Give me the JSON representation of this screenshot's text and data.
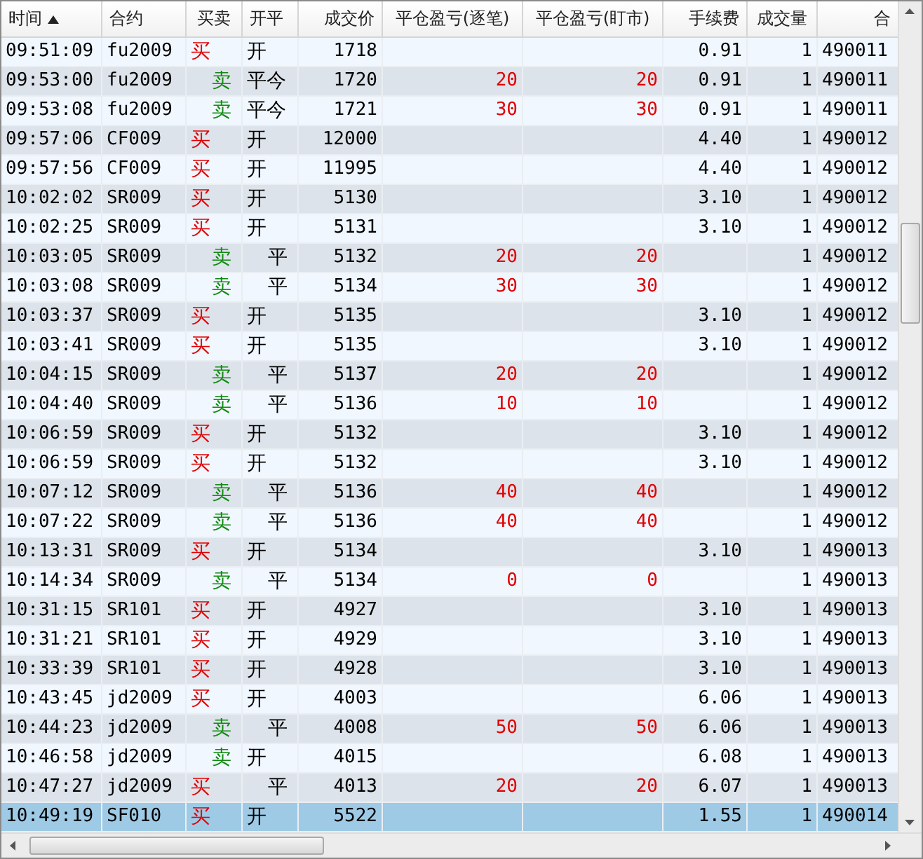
{
  "table": {
    "columns": [
      {
        "label": "时间",
        "sorted": true
      },
      {
        "label": "合约"
      },
      {
        "label": "买卖"
      },
      {
        "label": "开平"
      },
      {
        "label": "成交价"
      },
      {
        "label": "平仓盈亏(逐笔)"
      },
      {
        "label": "平仓盈亏(盯市)"
      },
      {
        "label": "手续费"
      },
      {
        "label": "成交量"
      },
      {
        "label": "合"
      }
    ],
    "rows": [
      {
        "time": "09:51:09",
        "contract": "fu2009",
        "side": {
          "kind": "buy",
          "label": "买"
        },
        "offset": {
          "kind": "open",
          "label": "开"
        },
        "price": "1718",
        "fee": "0.91",
        "volume": "1",
        "column_10": "490011",
        "selected": false
      },
      {
        "time": "09:53:00",
        "contract": "fu2009",
        "side": {
          "kind": "sell",
          "label": "卖"
        },
        "offset": {
          "kind": "today",
          "label": "平今"
        },
        "price": "1720",
        "pnl_trade": "20",
        "pnl_market": "20",
        "fee": "0.91",
        "volume": "1",
        "column_10": "490011",
        "selected": false
      },
      {
        "time": "09:53:08",
        "contract": "fu2009",
        "side": {
          "kind": "sell",
          "label": "卖"
        },
        "offset": {
          "kind": "today",
          "label": "平今"
        },
        "price": "1721",
        "pnl_trade": "30",
        "pnl_market": "30",
        "fee": "0.91",
        "volume": "1",
        "column_10": "490011",
        "selected": false
      },
      {
        "time": "09:57:06",
        "contract": "CF009",
        "side": {
          "kind": "buy",
          "label": "买"
        },
        "offset": {
          "kind": "open",
          "label": "开"
        },
        "price": "12000",
        "fee": "4.40",
        "volume": "1",
        "column_10": "490012",
        "selected": false
      },
      {
        "time": "09:57:56",
        "contract": "CF009",
        "side": {
          "kind": "buy",
          "label": "买"
        },
        "offset": {
          "kind": "open",
          "label": "开"
        },
        "price": "11995",
        "fee": "4.40",
        "volume": "1",
        "column_10": "490012",
        "selected": false
      },
      {
        "time": "10:02:02",
        "contract": "SR009",
        "side": {
          "kind": "buy",
          "label": "买"
        },
        "offset": {
          "kind": "open",
          "label": "开"
        },
        "price": "5130",
        "fee": "3.10",
        "volume": "1",
        "column_10": "490012",
        "selected": false
      },
      {
        "time": "10:02:25",
        "contract": "SR009",
        "side": {
          "kind": "buy",
          "label": "买"
        },
        "offset": {
          "kind": "open",
          "label": "开"
        },
        "price": "5131",
        "fee": "3.10",
        "volume": "1",
        "column_10": "490012",
        "selected": false
      },
      {
        "time": "10:03:05",
        "contract": "SR009",
        "side": {
          "kind": "sell",
          "label": "卖"
        },
        "offset": {
          "kind": "close",
          "label": "平"
        },
        "price": "5132",
        "pnl_trade": "20",
        "pnl_market": "20",
        "volume": "1",
        "column_10": "490012",
        "selected": false
      },
      {
        "time": "10:03:08",
        "contract": "SR009",
        "side": {
          "kind": "sell",
          "label": "卖"
        },
        "offset": {
          "kind": "close",
          "label": "平"
        },
        "price": "5134",
        "pnl_trade": "30",
        "pnl_market": "30",
        "volume": "1",
        "column_10": "490012",
        "selected": false
      },
      {
        "time": "10:03:37",
        "contract": "SR009",
        "side": {
          "kind": "buy",
          "label": "买"
        },
        "offset": {
          "kind": "open",
          "label": "开"
        },
        "price": "5135",
        "fee": "3.10",
        "volume": "1",
        "column_10": "490012",
        "selected": false
      },
      {
        "time": "10:03:41",
        "contract": "SR009",
        "side": {
          "kind": "buy",
          "label": "买"
        },
        "offset": {
          "kind": "open",
          "label": "开"
        },
        "price": "5135",
        "fee": "3.10",
        "volume": "1",
        "column_10": "490012",
        "selected": false
      },
      {
        "time": "10:04:15",
        "contract": "SR009",
        "side": {
          "kind": "sell",
          "label": "卖"
        },
        "offset": {
          "kind": "close",
          "label": "平"
        },
        "price": "5137",
        "pnl_trade": "20",
        "pnl_market": "20",
        "volume": "1",
        "column_10": "490012",
        "selected": false
      },
      {
        "time": "10:04:40",
        "contract": "SR009",
        "side": {
          "kind": "sell",
          "label": "卖"
        },
        "offset": {
          "kind": "close",
          "label": "平"
        },
        "price": "5136",
        "pnl_trade": "10",
        "pnl_market": "10",
        "volume": "1",
        "column_10": "490012",
        "selected": false
      },
      {
        "time": "10:06:59",
        "contract": "SR009",
        "side": {
          "kind": "buy",
          "label": "买"
        },
        "offset": {
          "kind": "open",
          "label": "开"
        },
        "price": "5132",
        "fee": "3.10",
        "volume": "1",
        "column_10": "490012",
        "selected": false
      },
      {
        "time": "10:06:59",
        "contract": "SR009",
        "side": {
          "kind": "buy",
          "label": "买"
        },
        "offset": {
          "kind": "open",
          "label": "开"
        },
        "price": "5132",
        "fee": "3.10",
        "volume": "1",
        "column_10": "490012",
        "selected": false
      },
      {
        "time": "10:07:12",
        "contract": "SR009",
        "side": {
          "kind": "sell",
          "label": "卖"
        },
        "offset": {
          "kind": "close",
          "label": "平"
        },
        "price": "5136",
        "pnl_trade": "40",
        "pnl_market": "40",
        "volume": "1",
        "column_10": "490012",
        "selected": false
      },
      {
        "time": "10:07:22",
        "contract": "SR009",
        "side": {
          "kind": "sell",
          "label": "卖"
        },
        "offset": {
          "kind": "close",
          "label": "平"
        },
        "price": "5136",
        "pnl_trade": "40",
        "pnl_market": "40",
        "volume": "1",
        "column_10": "490012",
        "selected": false
      },
      {
        "time": "10:13:31",
        "contract": "SR009",
        "side": {
          "kind": "buy",
          "label": "买"
        },
        "offset": {
          "kind": "open",
          "label": "开"
        },
        "price": "5134",
        "fee": "3.10",
        "volume": "1",
        "column_10": "490013",
        "selected": false
      },
      {
        "time": "10:14:34",
        "contract": "SR009",
        "side": {
          "kind": "sell",
          "label": "卖"
        },
        "offset": {
          "kind": "close",
          "label": "平"
        },
        "price": "5134",
        "pnl_trade": "0",
        "pnl_market": "0",
        "volume": "1",
        "column_10": "490013",
        "selected": false
      },
      {
        "time": "10:31:15",
        "contract": "SR101",
        "side": {
          "kind": "buy",
          "label": "买"
        },
        "offset": {
          "kind": "open",
          "label": "开"
        },
        "price": "4927",
        "fee": "3.10",
        "volume": "1",
        "column_10": "490013",
        "selected": false
      },
      {
        "time": "10:31:21",
        "contract": "SR101",
        "side": {
          "kind": "buy",
          "label": "买"
        },
        "offset": {
          "kind": "open",
          "label": "开"
        },
        "price": "4929",
        "fee": "3.10",
        "volume": "1",
        "column_10": "490013",
        "selected": false
      },
      {
        "time": "10:33:39",
        "contract": "SR101",
        "side": {
          "kind": "buy",
          "label": "买"
        },
        "offset": {
          "kind": "open",
          "label": "开"
        },
        "price": "4928",
        "fee": "3.10",
        "volume": "1",
        "column_10": "490013",
        "selected": false
      },
      {
        "time": "10:43:45",
        "contract": "jd2009",
        "side": {
          "kind": "buy",
          "label": "买"
        },
        "offset": {
          "kind": "open",
          "label": "开"
        },
        "price": "4003",
        "fee": "6.06",
        "volume": "1",
        "column_10": "490013",
        "selected": false
      },
      {
        "time": "10:44:23",
        "contract": "jd2009",
        "side": {
          "kind": "sell",
          "label": "卖"
        },
        "offset": {
          "kind": "close",
          "label": "平"
        },
        "price": "4008",
        "pnl_trade": "50",
        "pnl_market": "50",
        "fee": "6.06",
        "volume": "1",
        "column_10": "490013",
        "selected": false
      },
      {
        "time": "10:46:58",
        "contract": "jd2009",
        "side": {
          "kind": "sell",
          "label": "卖"
        },
        "offset": {
          "kind": "open",
          "label": "开"
        },
        "price": "4015",
        "fee": "6.08",
        "volume": "1",
        "column_10": "490013",
        "selected": false
      },
      {
        "time": "10:47:27",
        "contract": "jd2009",
        "side": {
          "kind": "buy",
          "label": "买"
        },
        "offset": {
          "kind": "close",
          "label": "平"
        },
        "price": "4013",
        "pnl_trade": "20",
        "pnl_market": "20",
        "fee": "6.07",
        "volume": "1",
        "column_10": "490013",
        "selected": false
      },
      {
        "time": "10:49:19",
        "contract": "SF010",
        "side": {
          "kind": "buy",
          "label": "买"
        },
        "offset": {
          "kind": "open",
          "label": "开"
        },
        "price": "5522",
        "fee": "1.55",
        "volume": "1",
        "column_10": "490014",
        "selected": true
      }
    ]
  }
}
